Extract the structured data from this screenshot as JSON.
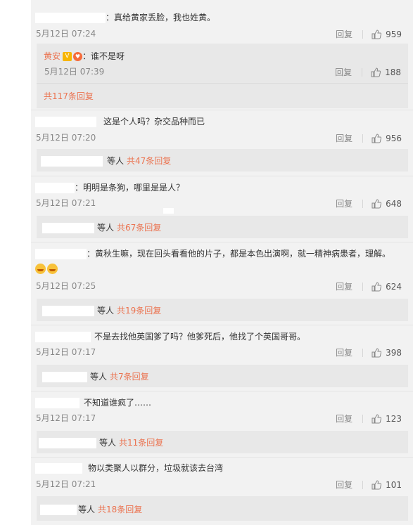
{
  "ui": {
    "reply_label": "回复",
    "etc_label": "等人",
    "accent_color": "#eb7350",
    "like_icon": "thumbs-up-icon"
  },
  "comments": [
    {
      "text": "：真给黄家丢脸，我也姓黄。",
      "time": "5月12日 07:24",
      "likes": "959",
      "sub_reply": {
        "user": "黄安",
        "text": "：谁不是呀",
        "time": "5月12日 07:39",
        "likes": "188"
      },
      "more_link": "共117条回复"
    },
    {
      "text": "这是个人吗？杂交品种而已",
      "time": "5月12日 07:20",
      "likes": "956",
      "more_link": "共47条回复"
    },
    {
      "text": "：明明是条狗，哪里是是人？",
      "time": "5月12日 07:21",
      "likes": "648",
      "more_link": "共67条回复"
    },
    {
      "text": "：黄秋生嘛，现在回头看看他的片子，都是本色出演啊，就一精神病患者，理解。",
      "time": "5月12日 07:25",
      "likes": "624",
      "more_link": "共19条回复"
    },
    {
      "text": "不是去找他英国爹了吗？他爹死后，他找了个英国哥哥。",
      "time": "5月12日 07:17",
      "likes": "398",
      "more_link": "共7条回复"
    },
    {
      "text": "不知道谁疯了……",
      "time": "5月12日 07:17",
      "likes": "123",
      "more_link": "共11条回复"
    },
    {
      "text": "物以类聚人以群分，垃圾就该去台湾",
      "time": "5月12日 07:21",
      "likes": "101",
      "more_link": "共18条回复"
    }
  ]
}
